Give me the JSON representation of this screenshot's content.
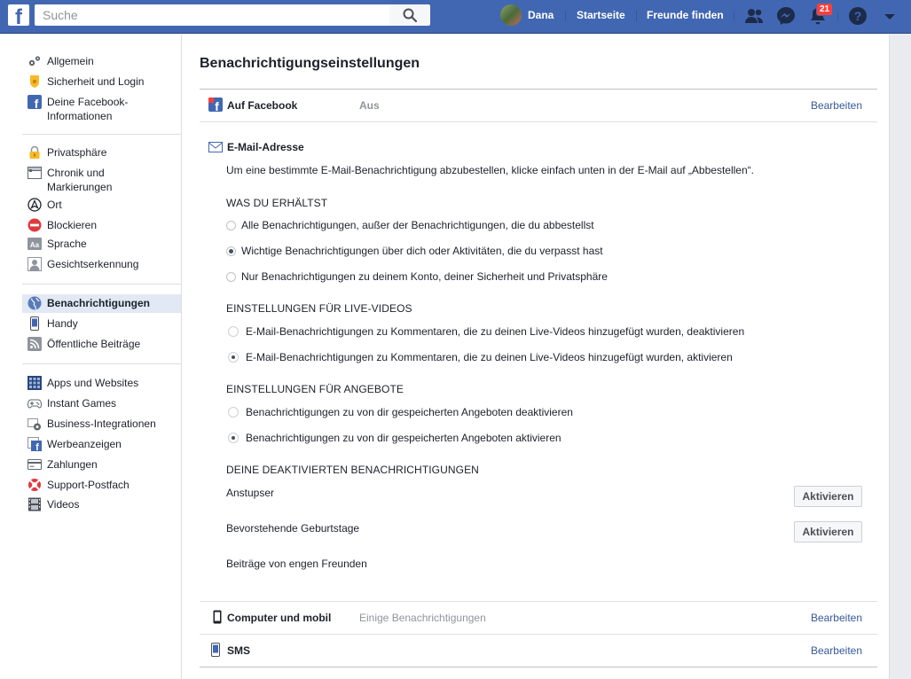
{
  "topbar": {
    "logo_letter": "f",
    "search_placeholder": "Suche",
    "user_name": "Dana",
    "nav_home": "Startseite",
    "nav_find_friends": "Freunde finden",
    "notification_count": "21",
    "brand_color": "#4267b2"
  },
  "sidebar": {
    "group1": [
      {
        "label": "Allgemein",
        "icon": "gear-icon"
      },
      {
        "label": "Sicherheit und Login",
        "icon": "shield-icon"
      },
      {
        "label": "Deine Facebook-Informationen",
        "icon": "facebook-icon"
      }
    ],
    "group2": [
      {
        "label": "Privatsphäre",
        "icon": "lock-icon"
      },
      {
        "label": "Chronik und Markierungen",
        "icon": "timeline-icon"
      },
      {
        "label": "Ort",
        "icon": "location-icon"
      },
      {
        "label": "Blockieren",
        "icon": "block-icon"
      },
      {
        "label": "Sprache",
        "icon": "language-icon"
      },
      {
        "label": "Gesichtserkennung",
        "icon": "face-recognition-icon"
      }
    ],
    "group3": [
      {
        "label": "Benachrichtigungen",
        "icon": "globe-icon",
        "active": true
      },
      {
        "label": "Handy",
        "icon": "phone-icon"
      },
      {
        "label": "Öffentliche Beiträge",
        "icon": "rss-icon"
      }
    ],
    "group4": [
      {
        "label": "Apps und Websites",
        "icon": "apps-icon"
      },
      {
        "label": "Instant Games",
        "icon": "gamepad-icon"
      },
      {
        "label": "Business-Integrationen",
        "icon": "business-gear-icon"
      },
      {
        "label": "Werbeanzeigen",
        "icon": "ads-icon"
      },
      {
        "label": "Zahlungen",
        "icon": "payment-card-icon"
      },
      {
        "label": "Support-Postfach",
        "icon": "lifebuoy-icon"
      },
      {
        "label": "Videos",
        "icon": "film-icon"
      }
    ]
  },
  "main": {
    "title": "Benachrichtigungseinstellungen",
    "on_facebook": {
      "label": "Auf Facebook",
      "value": "Aus",
      "edit": "Bearbeiten"
    },
    "email": {
      "label": "E-Mail-Adresse",
      "description": "Um eine bestimmte E-Mail-Benachrichtigung abzubestellen, klicke einfach unten in der E-Mail auf „Abbestellen“.",
      "receive_heading": "WAS DU ERHÄLTST",
      "receive_options": [
        {
          "label": "Alle Benachrichtigungen, außer der Benachrichtigungen, die du abbestellst",
          "selected": false
        },
        {
          "label": "Wichtige Benachrichtigungen über dich oder Aktivitäten, die du verpasst hast",
          "selected": true
        },
        {
          "label": "Nur Benachrichtigungen zu deinem Konto, deiner Sicherheit und Privatsphäre",
          "selected": false
        }
      ],
      "live_heading": "EINSTELLUNGEN FÜR LIVE-VIDEOS",
      "live_options": [
        {
          "label": "E-Mail-Benachrichtigungen zu Kommentaren, die zu deinen Live-Videos hinzugefügt wurden, deaktivieren",
          "selected": false
        },
        {
          "label": "E-Mail-Benachrichtigungen zu Kommentaren, die zu deinen Live-Videos hinzugefügt wurden, aktivieren",
          "selected": true
        }
      ],
      "offers_heading": "EINSTELLUNGEN FÜR ANGEBOTE",
      "offers_options": [
        {
          "label": "Benachrichtigungen zu von dir gespeicherten Angeboten deaktivieren",
          "selected": false
        },
        {
          "label": "Benachrichtigungen zu von dir gespeicherten Angeboten aktivieren",
          "selected": true
        }
      ],
      "deactivated_heading": "DEINE DEAKTIVIERTEN BENACHRICHTIGUNGEN",
      "deactivated": [
        {
          "label": "Anstupser",
          "button": "Aktivieren"
        },
        {
          "label": "Bevorstehende Geburtstage",
          "button": "Aktivieren"
        },
        {
          "label": "Beiträge von engen Freunden"
        }
      ]
    },
    "computer_mobile": {
      "label": "Computer und mobil",
      "value": "Einige Benachrichtigungen",
      "edit": "Bearbeiten"
    },
    "sms": {
      "label": "SMS",
      "edit": "Bearbeiten"
    }
  }
}
